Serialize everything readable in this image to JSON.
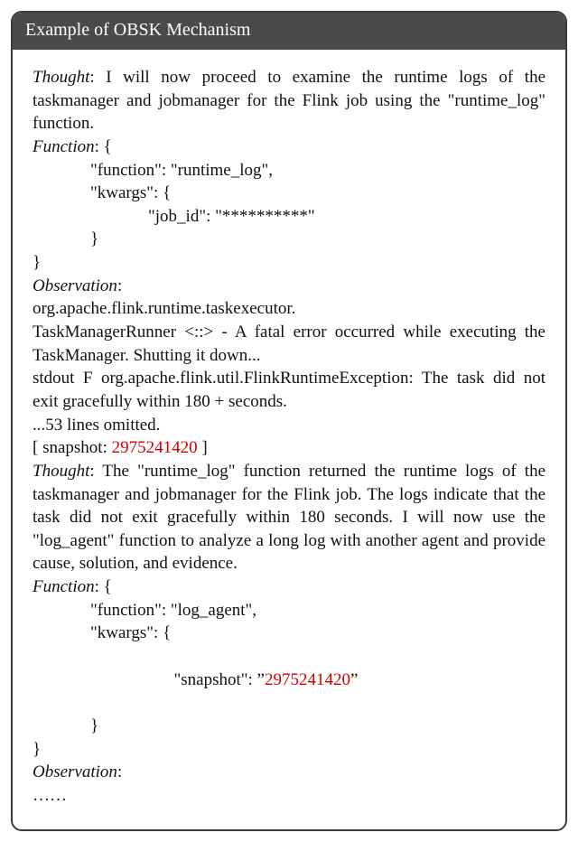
{
  "card": {
    "title": "Example of OBSK Mechanism",
    "thought1_label": "Thought",
    "thought1_text": ": I will now proceed to examine the runtime logs of the taskmanager and jobmanager for the Flink job using the \"runtime_log\" function.",
    "function_label": "Function",
    "func1_open": ": {",
    "func1_l1": "\"function\": \"runtime_log\",",
    "func1_l2": "\"kwargs\": {",
    "func1_l3": "\"job_id\": \"**********\"",
    "func1_l4": "}",
    "func1_close": "}",
    "observation_label": "Observation",
    "obs_colon": ":",
    "obs_l1": "org.apache.flink.runtime.taskexecutor.",
    "obs_l2": "TaskManagerRunner <::> - A fatal error occurred while executing the TaskManager. Shutting it down...",
    "obs_l3": "stdout F org.apache.flink.util.FlinkRuntimeException: The task did not exit gracefully within 180 + seconds.",
    "obs_l4": "...53 lines omitted.",
    "snapshot_prefix": "[ snapshot: ",
    "snapshot_value": "2975241420",
    "snapshot_suffix": " ]",
    "thought2_text": ": The \"runtime_log\" function returned the runtime logs of the taskmanager and jobmanager for the Flink job. The logs indicate that the task did not exit gracefully within 180 seconds. I will now use the \"log_agent\" function to analyze a long log with another agent and provide cause, solution, and evidence.",
    "func2_l1": "\"function\": \"log_agent\",",
    "func2_l2": "\"kwargs\": {",
    "func2_l3a": "\"snapshot\": ”",
    "func2_l3b": "2975241420",
    "func2_l3c": "”",
    "obs2_text": "……"
  }
}
